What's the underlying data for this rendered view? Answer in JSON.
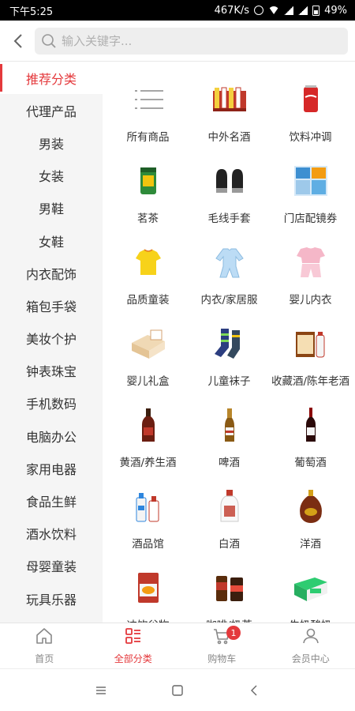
{
  "status_bar": {
    "time": "下午5:25",
    "network_speed": "467K/s",
    "battery": "49%",
    "icons": [
      "alarm-icon",
      "wifi-icon",
      "signal-icon",
      "signal-icon",
      "battery-icon"
    ]
  },
  "header": {
    "back_icon": "chevron-left-icon",
    "search_icon": "search-icon",
    "search_placeholder": "输入关键字...",
    "search_value": ""
  },
  "sidebar": {
    "active_index": 0,
    "items": [
      {
        "label": "推荐分类"
      },
      {
        "label": "代理产品"
      },
      {
        "label": "男装"
      },
      {
        "label": "女装"
      },
      {
        "label": "男鞋"
      },
      {
        "label": "女鞋"
      },
      {
        "label": "内衣配饰"
      },
      {
        "label": "箱包手袋"
      },
      {
        "label": "美妆个护"
      },
      {
        "label": "钟表珠宝"
      },
      {
        "label": "手机数码"
      },
      {
        "label": "电脑办公"
      },
      {
        "label": "家用电器"
      },
      {
        "label": "食品生鲜"
      },
      {
        "label": "酒水饮料"
      },
      {
        "label": "母婴童装"
      },
      {
        "label": "玩具乐器"
      }
    ]
  },
  "categories": [
    {
      "label": "所有商品",
      "icon": "list-icon"
    },
    {
      "label": "中外名酒",
      "icon": "liquor-set-icon"
    },
    {
      "label": "饮料冲调",
      "icon": "soda-can-icon"
    },
    {
      "label": "茗茶",
      "icon": "tea-canister-icon"
    },
    {
      "label": "毛线手套",
      "icon": "gloves-icon"
    },
    {
      "label": "门店配镜券",
      "icon": "coupon-icon"
    },
    {
      "label": "品质童装",
      "icon": "kids-shirt-icon"
    },
    {
      "label": "内衣/家居服",
      "icon": "onesie-icon"
    },
    {
      "label": "婴儿内衣",
      "icon": "baby-pajamas-icon"
    },
    {
      "label": "婴儿礼盒",
      "icon": "gift-box-icon"
    },
    {
      "label": "儿童袜子",
      "icon": "socks-icon"
    },
    {
      "label": "收藏酒/陈年老酒",
      "icon": "collector-liquor-icon"
    },
    {
      "label": "黄酒/养生酒",
      "icon": "wine-bottle-icon"
    },
    {
      "label": "啤酒",
      "icon": "beer-bottle-icon"
    },
    {
      "label": "葡萄酒",
      "icon": "red-wine-icon"
    },
    {
      "label": "酒品馆",
      "icon": "liquor-bottles-icon"
    },
    {
      "label": "白酒",
      "icon": "baijiu-icon"
    },
    {
      "label": "洋酒",
      "icon": "cognac-icon"
    },
    {
      "label": "冲饮谷物",
      "icon": "cereal-bag-icon"
    },
    {
      "label": "咖啡/奶茶",
      "icon": "coffee-jar-icon"
    },
    {
      "label": "牛奶酸奶",
      "icon": "milk-carton-icon"
    }
  ],
  "tabbar": {
    "active_index": 1,
    "tabs": [
      {
        "label": "首页",
        "icon": "home-icon"
      },
      {
        "label": "全部分类",
        "icon": "category-icon"
      },
      {
        "label": "购物车",
        "icon": "cart-icon",
        "badge": "1"
      },
      {
        "label": "会员中心",
        "icon": "user-icon"
      }
    ]
  },
  "navbar": {
    "icons": [
      "menu-icon",
      "home-square-icon",
      "back-triangle-icon"
    ]
  },
  "colors": {
    "accent": "#e4393c",
    "sidebar_bg": "#f5f5f5",
    "search_bg": "#eeeeee"
  }
}
